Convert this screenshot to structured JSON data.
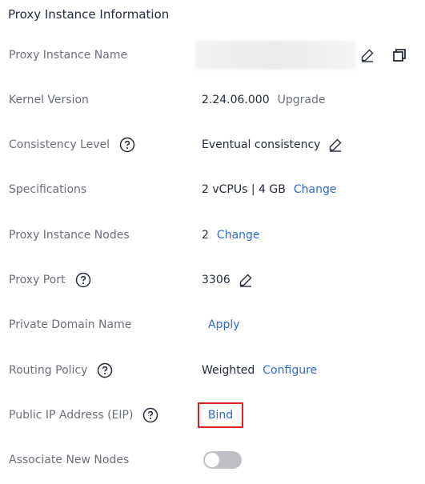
{
  "section": {
    "title": "Proxy Instance Information"
  },
  "rows": {
    "name": {
      "label": "Proxy Instance Name"
    },
    "kernel": {
      "label": "Kernel Version",
      "value": "2.24.06.000",
      "action": "Upgrade"
    },
    "consistency": {
      "label": "Consistency Level",
      "value": "Eventual consistency"
    },
    "specs": {
      "label": "Specifications",
      "value": "2 vCPUs | 4 GB",
      "action": "Change"
    },
    "nodes": {
      "label": "Proxy Instance Nodes",
      "value": "2",
      "action": "Change"
    },
    "port": {
      "label": "Proxy Port",
      "value": "3306"
    },
    "domain": {
      "label": "Private Domain Name",
      "action": "Apply"
    },
    "routing": {
      "label": "Routing Policy",
      "value": "Weighted",
      "action": "Configure"
    },
    "eip": {
      "label": "Public IP Address (EIP)",
      "action": "Bind"
    },
    "associate": {
      "label": "Associate New Nodes",
      "toggle_on": false
    }
  },
  "colors": {
    "link": "#2b6ad6",
    "highlight_border": "#e02020",
    "label": "#6b6f79"
  },
  "icons": {
    "edit": "pencil-edit-icon",
    "copy": "copy-icon",
    "help": "question-circle-icon"
  }
}
